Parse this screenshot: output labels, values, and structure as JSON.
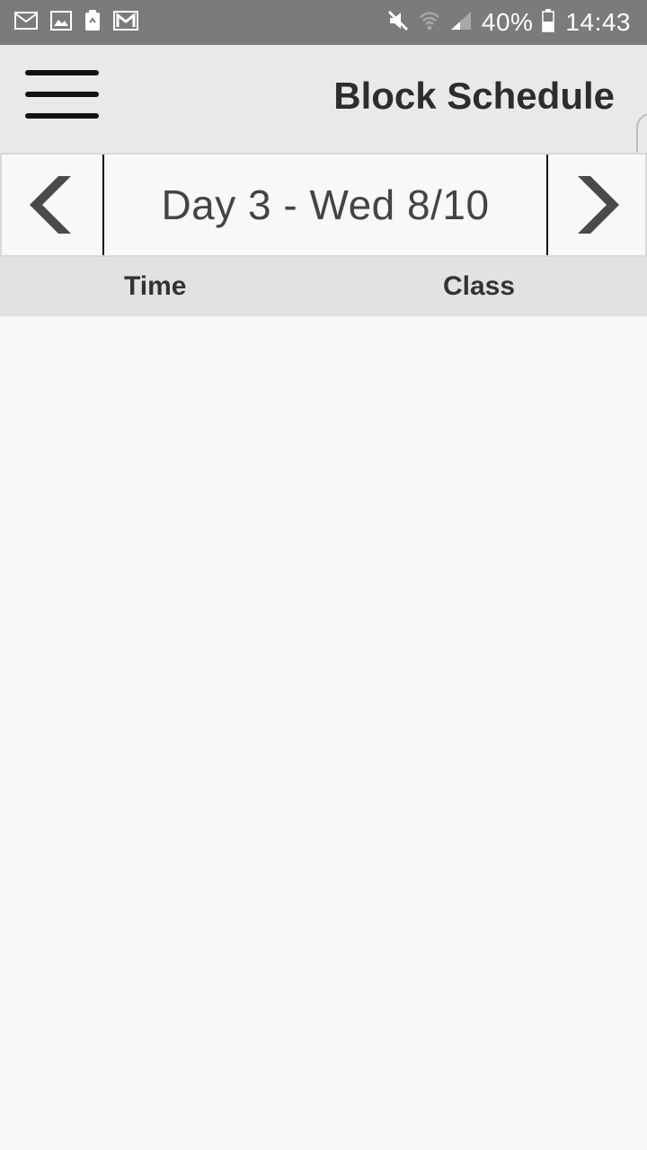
{
  "status_bar": {
    "icons_left": [
      "mail-icon",
      "image-icon",
      "battery-saver-icon",
      "gmail-icon"
    ],
    "icons_right": [
      "mute-icon",
      "wifi-icon",
      "signal-icon"
    ],
    "battery_percent": "40%",
    "time": "14:43"
  },
  "header": {
    "title": "Block Schedule",
    "menu_icon": "hamburger-menu-icon"
  },
  "day_nav": {
    "label": "Day 3 - Wed 8/10",
    "prev_icon": "chevron-left-icon",
    "next_icon": "chevron-right-icon"
  },
  "table": {
    "columns": [
      "Time",
      "Class"
    ],
    "rows": []
  },
  "colors": {
    "status_bar_bg": "#7b7b7b",
    "header_bg": "#e9e9e9",
    "column_header_bg": "#e2e2e2",
    "body_bg": "#f8f8f8",
    "chevron": "#4a4a4a"
  }
}
